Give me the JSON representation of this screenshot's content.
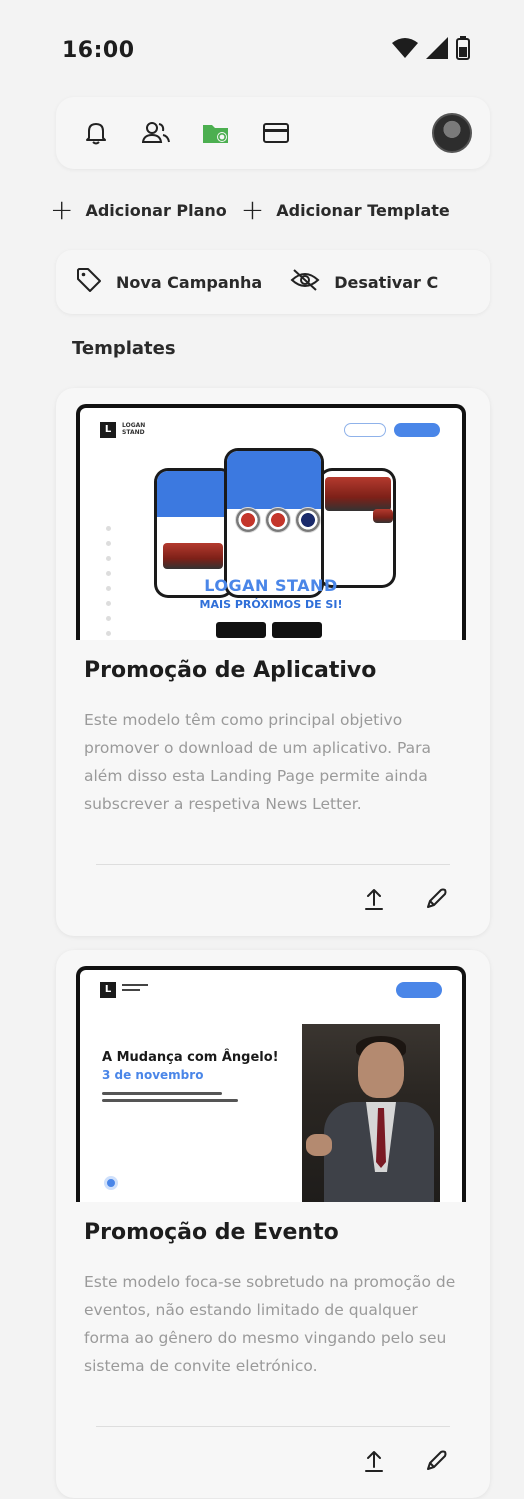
{
  "status_bar": {
    "time": "16:00",
    "icons": [
      "wifi-icon",
      "signal-icon",
      "battery-icon"
    ]
  },
  "toolbar": {
    "icons": [
      "bell-icon",
      "users-icon",
      "folder-icon",
      "credit-card-icon"
    ],
    "active_icon": "folder-icon",
    "active_color": "#4caf50",
    "avatar": "avatar"
  },
  "actions": {
    "add_plan": "Adicionar Plano",
    "add_template": "Adicionar Template"
  },
  "campaigns": {
    "new_campaign": "Nova Campanha",
    "deactivate": "Desativar C"
  },
  "section": {
    "title": "Templates"
  },
  "templates": [
    {
      "title": "Promoção de Aplicativo",
      "description": "Este modelo têm como principal objetivo promover o download de um aplicativo. Para além disso esta Landing Page permite ainda subscrever a respetiva News Letter.",
      "preview": {
        "logo_letter": "L",
        "logo_text": "LOGAN STAND",
        "headline": "LOGAN STAND",
        "subheadline": "MAIS PRÓXIMOS DE SI!"
      }
    },
    {
      "title": "Promoção de Evento",
      "description": "Este modelo foca-se sobretudo na promoção de eventos, não estando limitado de qualquer forma ao gênero do mesmo vingando pelo seu sistema de convite eletrónico.",
      "preview": {
        "logo_letter": "L",
        "headline": "A Mudança com Ângelo!",
        "subheadline": "3 de novembro"
      }
    }
  ],
  "colors": {
    "accent": "#4a86e8",
    "active_icon": "#4caf50",
    "background": "#f3f3f3"
  }
}
